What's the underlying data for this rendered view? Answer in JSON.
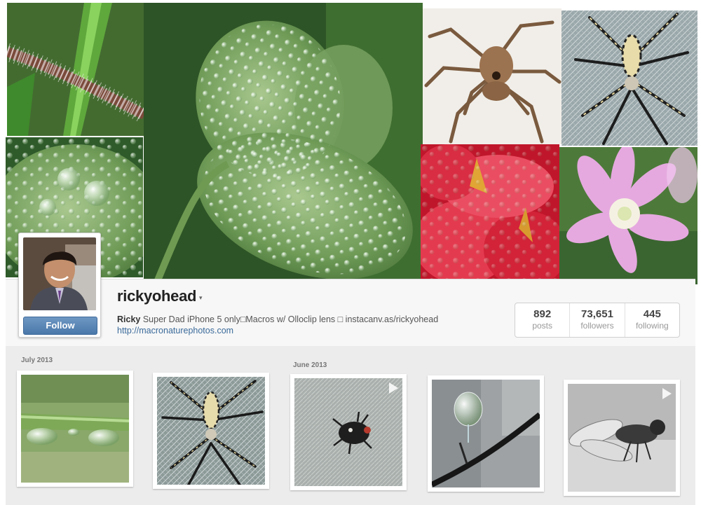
{
  "profile": {
    "username": "rickyohead",
    "caret": "▾",
    "bio_name": "Ricky",
    "bio_text": " Super Dad iPhone 5 only□Macros w/ Olloclip lens □ instacanv.as/rickyohead",
    "website": "http://macronaturephotos.com",
    "follow_label": "Follow"
  },
  "stats": [
    {
      "value": "892",
      "label": "posts"
    },
    {
      "value": "73,651",
      "label": "followers"
    },
    {
      "value": "445",
      "label": "following"
    }
  ],
  "feed": {
    "months": [
      "July 2013",
      "June 2013"
    ],
    "thumbnails": [
      {
        "subject": "water-drops-on-grass",
        "video": false
      },
      {
        "subject": "striped-spider-on-web",
        "video": false
      },
      {
        "subject": "small-spider-on-fabric",
        "video": true
      },
      {
        "subject": "drop-on-branch",
        "video": false
      },
      {
        "subject": "fly-black-and-white",
        "video": true
      }
    ]
  },
  "colors": {
    "follow_button": "#4a78aa",
    "link": "#3a6a9a",
    "band_background": "#f7f7f7",
    "feed_background": "#ececec"
  }
}
